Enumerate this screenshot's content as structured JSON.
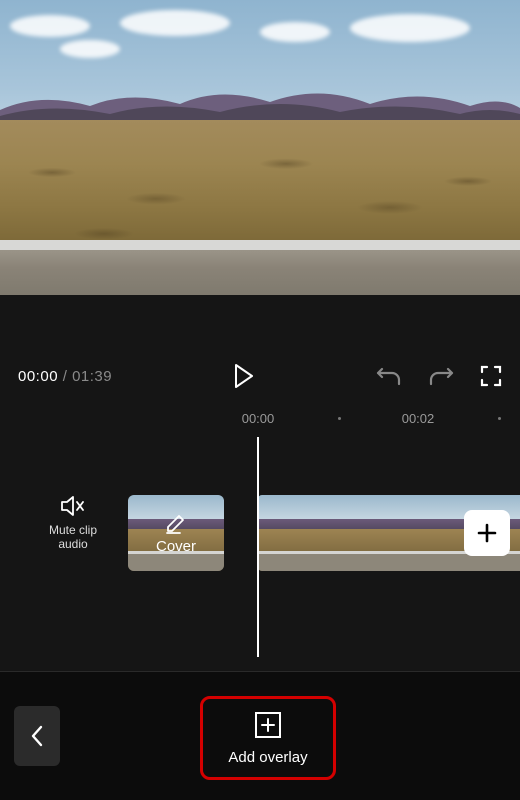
{
  "playback": {
    "current_time": "00:00",
    "separator": " / ",
    "duration": "01:39"
  },
  "ruler": {
    "marks": [
      {
        "pos": 258,
        "label": "00:00"
      },
      {
        "pos": 338,
        "label": "·"
      },
      {
        "pos": 418,
        "label": "00:02"
      },
      {
        "pos": 498,
        "label": "·"
      }
    ]
  },
  "track": {
    "mute_label_line1": "Mute clip",
    "mute_label_line2": "audio",
    "cover_label": "Cover"
  },
  "bottom": {
    "add_overlay_label": "Add overlay"
  },
  "icons": {
    "play": "play-icon",
    "undo": "undo-icon",
    "redo": "redo-icon",
    "fullscreen": "fullscreen-icon",
    "speaker": "speaker-mute-icon",
    "pencil": "pencil-icon",
    "plus": "plus-icon",
    "plus_box": "plus-box-icon",
    "chevron_left": "chevron-left-icon"
  }
}
